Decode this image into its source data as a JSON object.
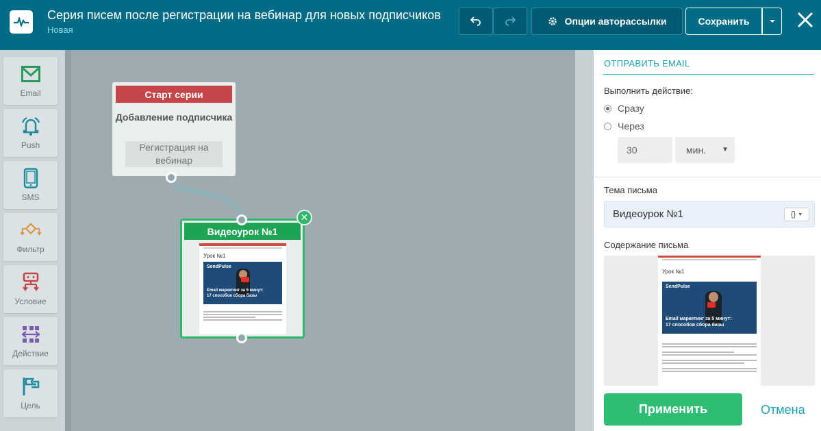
{
  "header": {
    "title": "Серия писем после регистрации на вебинар для новых подписчиков",
    "status": "Новая",
    "options_label": "Опции авторассылки",
    "save_label": "Сохранить"
  },
  "sidebar": {
    "items": [
      {
        "label": "Email",
        "icon": "envelope-icon"
      },
      {
        "label": "Push",
        "icon": "bell-icon"
      },
      {
        "label": "SMS",
        "icon": "phone-icon"
      },
      {
        "label": "Фильтр",
        "icon": "filter-icon"
      },
      {
        "label": "Условие",
        "icon": "condition-icon"
      },
      {
        "label": "Действие",
        "icon": "action-icon"
      },
      {
        "label": "Цель",
        "icon": "flag-icon"
      }
    ]
  },
  "flow": {
    "start_node": {
      "header": "Старт серии",
      "event": "Добавление подписчика",
      "segment": "Регистрация на вебинар"
    },
    "email_node": {
      "header": "Видеоурок №1",
      "preview_heading": "Урок №1",
      "preview_brand": "SendPulse",
      "preview_caption_1": "Email маркетинг за 5 минут:",
      "preview_caption_2": "17 способов сбора базы"
    }
  },
  "panel": {
    "title": "ОТПРАВИТЬ EMAIL",
    "action_label": "Выполнить действие:",
    "option_now": "Сразу",
    "option_after": "Через",
    "delay_value": "30",
    "delay_unit": "мин.",
    "subject_label": "Тема письма",
    "subject_value": "Видеоурок №1",
    "content_label": "Содержание письма",
    "apply_label": "Применить",
    "cancel_label": "Отмена"
  },
  "colors": {
    "header_bg": "#006c86",
    "start_red": "#c64548",
    "email_green": "#1ea554",
    "apply_green": "#2ebd74",
    "accent_teal": "#1ba2b5"
  }
}
